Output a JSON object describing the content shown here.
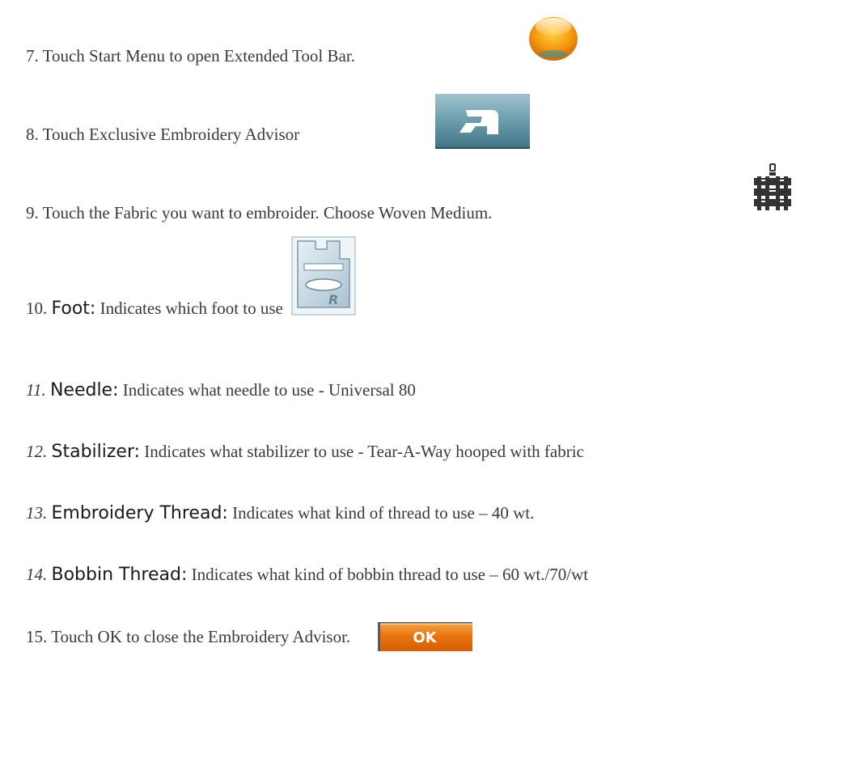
{
  "steps": [
    {
      "number": "7.",
      "text": "Touch Start Menu to open Extended Tool Bar."
    },
    {
      "number": "8.",
      "text": "Touch Exclusive Embroidery Advisor"
    },
    {
      "number": "9.",
      "text": "Touch the Fabric you want to embroider. Choose Woven Medium."
    },
    {
      "number": "10.",
      "term": "Foot:",
      "text": "Indicates which foot to use"
    },
    {
      "number": "11.",
      "term": "Needle:",
      "text": "Indicates what needle to use - Universal 80"
    },
    {
      "number": "12.",
      "term": "Stabilizer:",
      "text": "Indicates what stabilizer to use - Tear-A-Way hooped with fabric"
    },
    {
      "number": "13.",
      "term": "Embroidery Thread:",
      "text": "Indicates what kind of thread to use – 40 wt."
    },
    {
      "number": "14.",
      "term": "Bobbin Thread:",
      "text": "Indicates what kind of bobbin thread to use – 60 wt./70/wt"
    },
    {
      "number": "15.",
      "text": "Touch OK to close the Embroidery Advisor."
    }
  ],
  "icons": {
    "start_menu": "orange-orb-icon",
    "embroidery_advisor": "sewing-machine-icon",
    "fabric": "woven-fabric-icon",
    "foot": "presser-foot-r-icon",
    "foot_letter": "R",
    "ok_button_label": "OK"
  },
  "colors": {
    "orb": "#f39a12",
    "advisor_teal": "#4f8a9c",
    "ok_orange": "#e8730c"
  }
}
